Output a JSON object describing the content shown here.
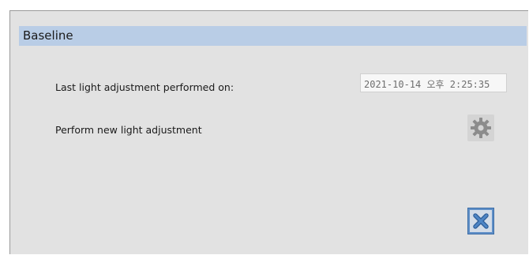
{
  "panel": {
    "title": "Baseline"
  },
  "last_adjustment": {
    "label": "Last light adjustment performed on:",
    "value": "2021-10-14 오후 2:25:35"
  },
  "new_adjustment": {
    "label": "Perform new light adjustment",
    "icon": "gear-icon"
  },
  "close": {
    "icon": "close-icon",
    "accent_color": "#5f8fc7"
  }
}
